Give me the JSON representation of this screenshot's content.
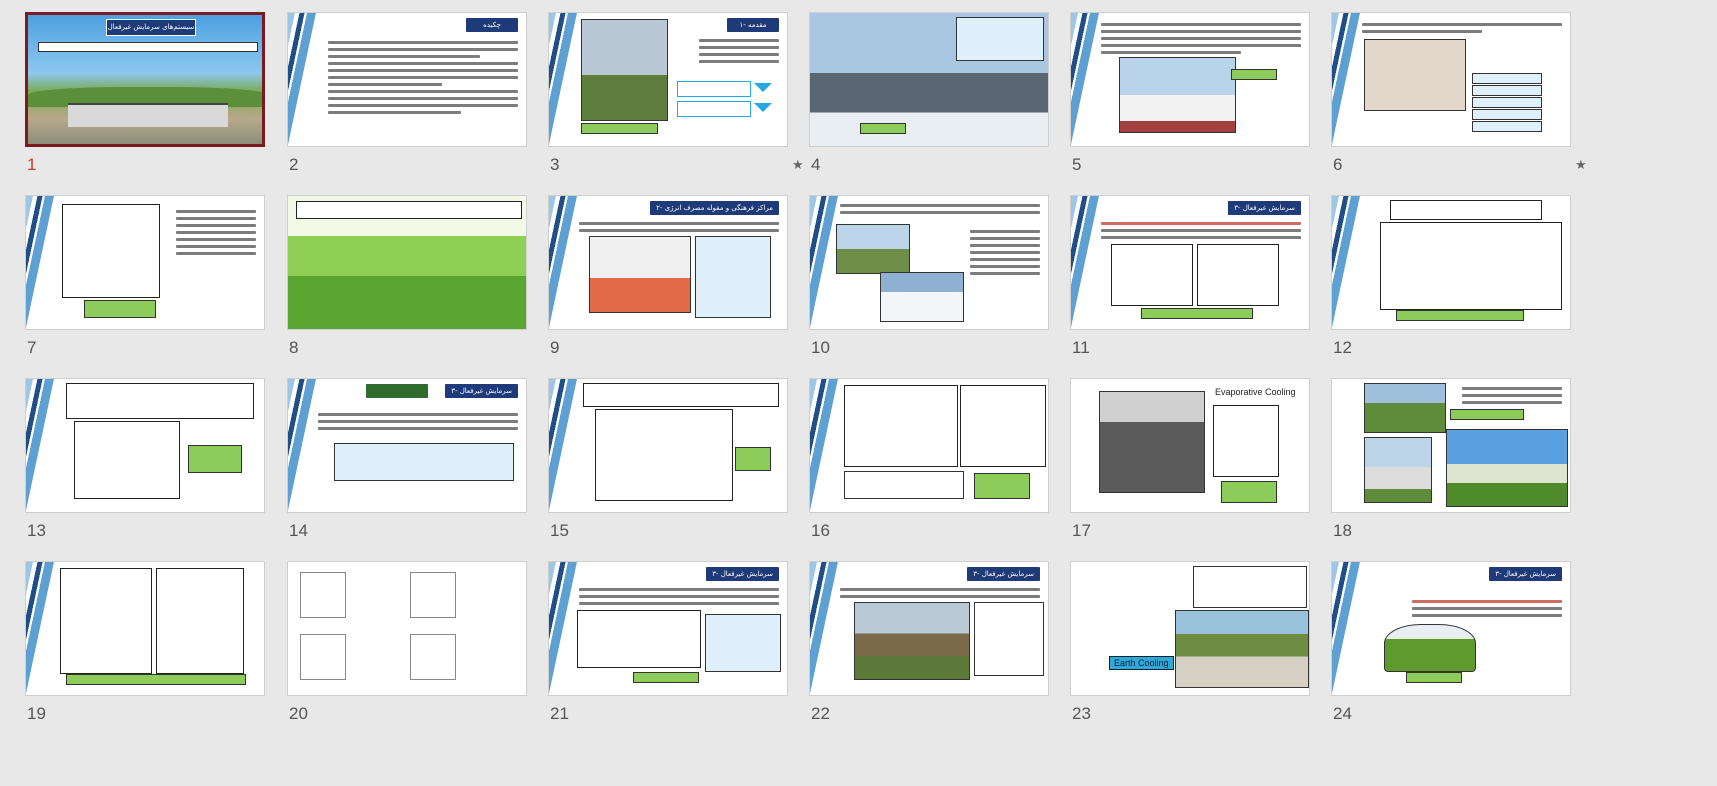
{
  "slides": [
    {
      "number": "1",
      "title": "سیستم‌های سرمایش غیرفعال",
      "selected": true,
      "starred": false
    },
    {
      "number": "2",
      "title": "چکیده",
      "selected": false,
      "starred": false
    },
    {
      "number": "3",
      "title": "۱- مقدمه",
      "selected": false,
      "starred": true
    },
    {
      "number": "4",
      "title": "",
      "selected": false,
      "starred": false
    },
    {
      "number": "5",
      "title": "",
      "selected": false,
      "starred": false
    },
    {
      "number": "6",
      "title": "",
      "selected": false,
      "starred": true
    },
    {
      "number": "7",
      "title": "",
      "selected": false,
      "starred": false
    },
    {
      "number": "8",
      "title": "",
      "selected": false,
      "starred": false
    },
    {
      "number": "9",
      "title": "۲- مراکز فرهنگی و مقوله مصرف انرژی",
      "selected": false,
      "starred": false
    },
    {
      "number": "10",
      "title": "",
      "selected": false,
      "starred": false
    },
    {
      "number": "11",
      "title": "۳- سرمایش غیرفعال",
      "selected": false,
      "starred": false
    },
    {
      "number": "12",
      "title": "",
      "selected": false,
      "starred": false
    },
    {
      "number": "13",
      "title": "",
      "selected": false,
      "starred": false
    },
    {
      "number": "14",
      "title": "۳- سرمایش غیرفعال",
      "selected": false,
      "starred": false
    },
    {
      "number": "15",
      "title": "",
      "selected": false,
      "starred": false
    },
    {
      "number": "16",
      "title": "",
      "selected": false,
      "starred": false
    },
    {
      "number": "17",
      "title": "",
      "selected": false,
      "starred": false,
      "label": "Evaporative Cooling"
    },
    {
      "number": "18",
      "title": "",
      "selected": false,
      "starred": false
    },
    {
      "number": "19",
      "title": "",
      "selected": false,
      "starred": false
    },
    {
      "number": "20",
      "title": "",
      "selected": false,
      "starred": false
    },
    {
      "number": "21",
      "title": "۳- سرمایش غیرفعال",
      "selected": false,
      "starred": false
    },
    {
      "number": "22",
      "title": "۳- سرمایش غیرفعال",
      "selected": false,
      "starred": false
    },
    {
      "number": "23",
      "title": "",
      "selected": false,
      "starred": false,
      "label": "Earth Cooling"
    },
    {
      "number": "24",
      "title": "۳- سرمایش غیرفعال",
      "selected": false,
      "starred": false
    }
  ],
  "icons": {
    "star": "star-icon"
  },
  "colors": {
    "selection": "#7d1a1f",
    "title_bar": "#1e3a78",
    "caption": "#8dcb5a"
  }
}
